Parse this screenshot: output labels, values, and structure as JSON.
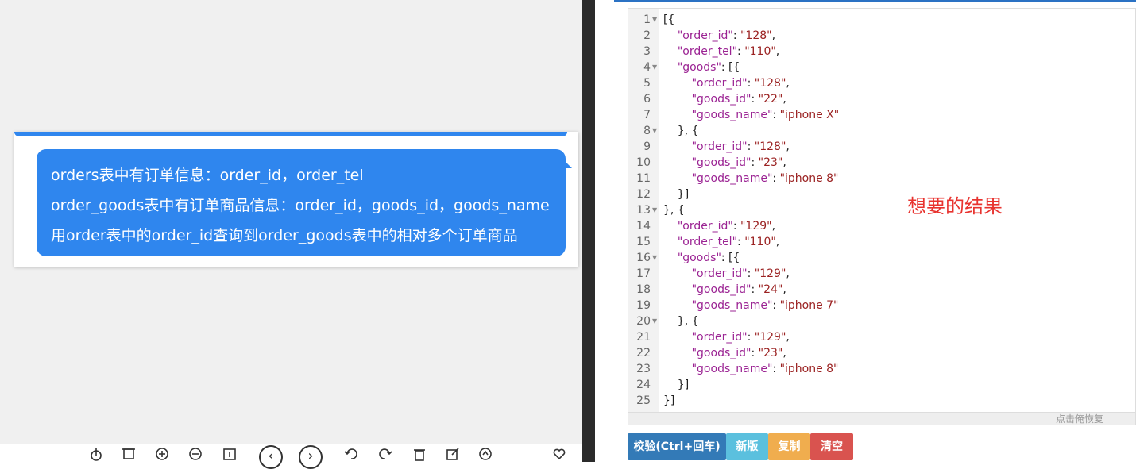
{
  "chat": {
    "lines": [
      "orders表中有订单信息：order_id，order_tel",
      "order_goods表中有订单商品信息：order_id，goods_id，goods_name",
      "用order表中的order_id查询到order_goods表中的相对多个订单商品"
    ]
  },
  "toolbar_icons": [
    "download-icon",
    "crop-icon",
    "zoom-in-icon",
    "zoom-out-icon",
    "fit-icon",
    "prev-icon",
    "next-icon",
    "rotate-left-icon",
    "rotate-right-icon",
    "delete-icon",
    "edit-icon",
    "locate-icon",
    "favorite-icon"
  ],
  "editor": {
    "lines": [
      "[{",
      "    \"order_id\": \"128\",",
      "    \"order_tel\": \"110\",",
      "    \"goods\": [{",
      "        \"order_id\": \"128\",",
      "        \"goods_id\": \"22\",",
      "        \"goods_name\": \"iphone X\"",
      "    }, {",
      "        \"order_id\": \"128\",",
      "        \"goods_id\": \"23\",",
      "        \"goods_name\": \"iphone 8\"",
      "    }]",
      "}, {",
      "    \"order_id\": \"129\",",
      "    \"order_tel\": \"110\",",
      "    \"goods\": [{",
      "        \"order_id\": \"129\",",
      "        \"goods_id\": \"24\",",
      "        \"goods_name\": \"iphone 7\"",
      "    }, {",
      "        \"order_id\": \"129\",",
      "        \"goods_id\": \"23\",",
      "        \"goods_name\": \"iphone 8\"",
      "    }]",
      "}]"
    ],
    "line_numbers": [
      "1",
      "2",
      "3",
      "4",
      "5",
      "6",
      "7",
      "8",
      "9",
      "10",
      "11",
      "12",
      "13",
      "14",
      "15",
      "16",
      "17",
      "18",
      "19",
      "20",
      "21",
      "22",
      "23",
      "24",
      "25"
    ],
    "foldable_lines": [
      1,
      4,
      8,
      13,
      16,
      20
    ],
    "status_text": "点击俺恢复"
  },
  "annotation": "想要的结果",
  "buttons": {
    "validate": "校验(Ctrl+回车)",
    "new": "新版",
    "copy": "复制",
    "clear": "清空"
  },
  "colors": {
    "bubble": "#2f86ee",
    "json_key": "#9b2393",
    "json_string": "#9b2222",
    "annotation": "#e8332f",
    "btn_validate": "#337ab7",
    "btn_new": "#5bc0de",
    "btn_copy": "#f0ad4e",
    "btn_clear": "#d9534f"
  }
}
